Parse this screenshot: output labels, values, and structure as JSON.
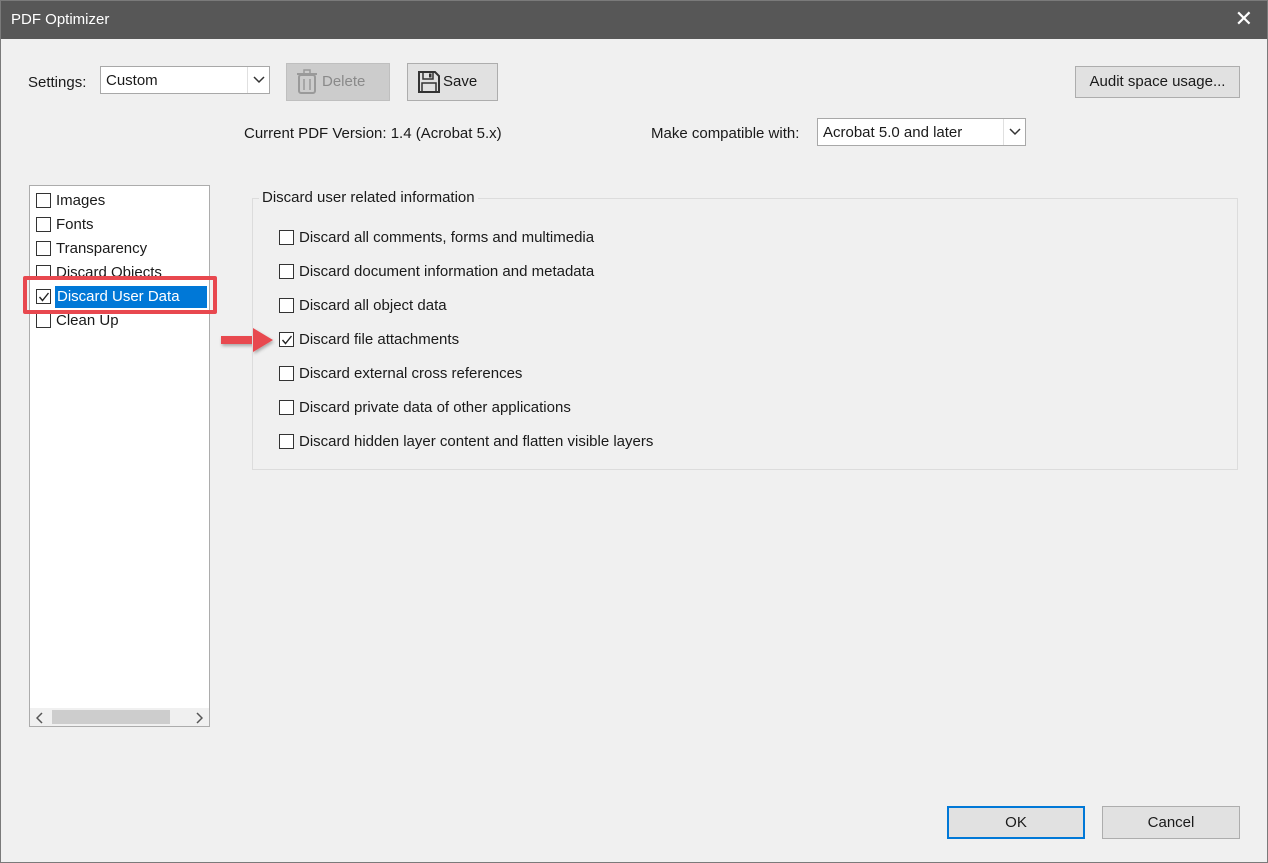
{
  "window": {
    "title": "PDF Optimizer"
  },
  "settings": {
    "label": "Settings:",
    "value": "Custom",
    "delete_label": "Delete",
    "save_label": "Save",
    "audit_label": "Audit space usage..."
  },
  "version": {
    "current_label": "Current PDF Version: 1.4 (Acrobat 5.x)",
    "compat_label": "Make compatible with:",
    "compat_value": "Acrobat 5.0 and later"
  },
  "sidebar": {
    "items": [
      {
        "label": "Images",
        "checked": false,
        "selected": false
      },
      {
        "label": "Fonts",
        "checked": false,
        "selected": false
      },
      {
        "label": "Transparency",
        "checked": false,
        "selected": false
      },
      {
        "label": "Discard Objects",
        "checked": false,
        "selected": false
      },
      {
        "label": "Discard User Data",
        "checked": true,
        "selected": true
      },
      {
        "label": "Clean Up",
        "checked": false,
        "selected": false
      }
    ]
  },
  "group": {
    "title": "Discard user related information",
    "options": [
      {
        "label": "Discard all comments, forms and multimedia",
        "checked": false
      },
      {
        "label": "Discard document information and metadata",
        "checked": false
      },
      {
        "label": "Discard all object data",
        "checked": false
      },
      {
        "label": "Discard file attachments",
        "checked": true
      },
      {
        "label": "Discard external cross references",
        "checked": false
      },
      {
        "label": "Discard private data of other applications",
        "checked": false
      },
      {
        "label": "Discard hidden layer content and flatten visible layers",
        "checked": false
      }
    ]
  },
  "footer": {
    "ok_label": "OK",
    "cancel_label": "Cancel"
  },
  "colors": {
    "accent": "#0078d7",
    "annotation": "#e8484f",
    "titlebar": "#575757"
  }
}
